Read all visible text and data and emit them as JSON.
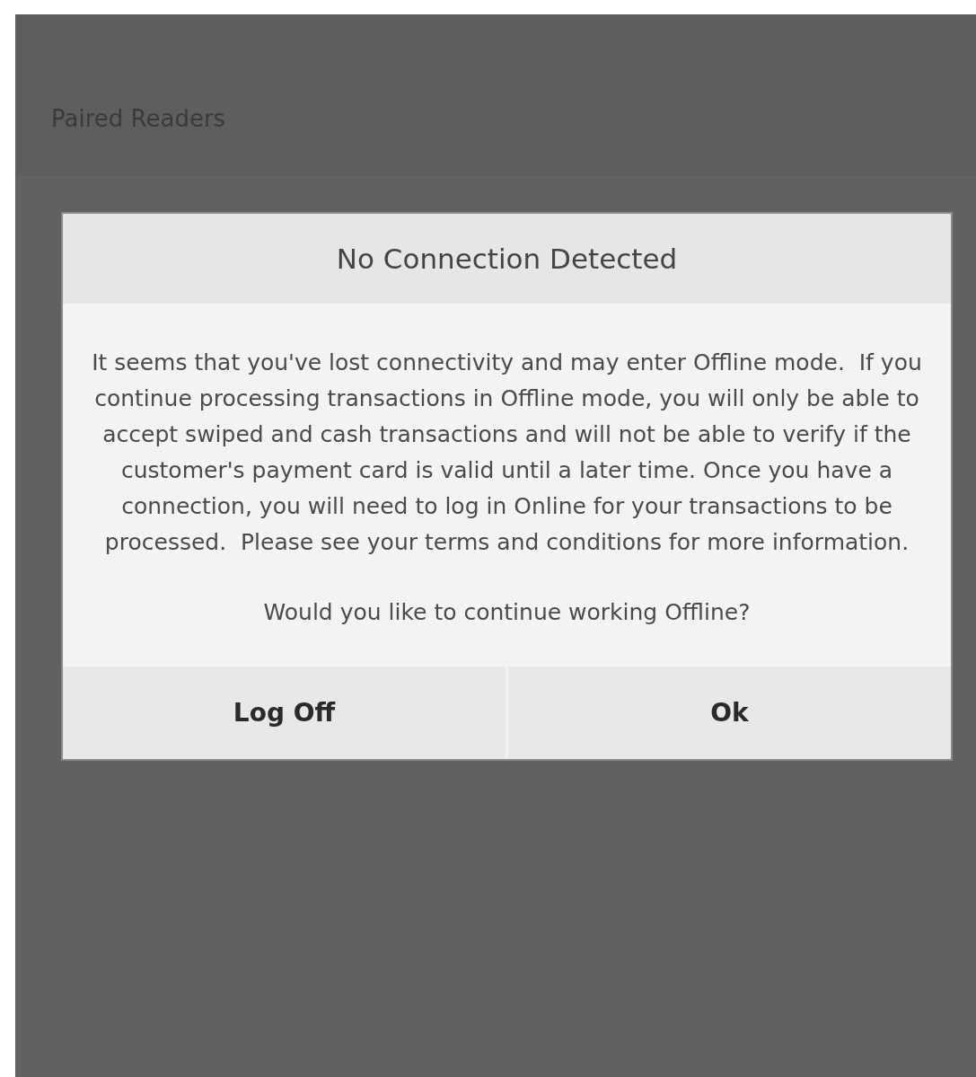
{
  "screen": {
    "header": "Paired Readers"
  },
  "dialog": {
    "title": "No Connection Detected",
    "message": "It seems that you've lost connectivity and may enter Offline mode.  If you continue processing transactions in Offline mode, you will only be able to accept swiped and cash transactions and will not be able to verify if the customer's payment card is valid until a later time. Once you have a connection, you will need to log in Online for your transactions to be processed.  Please see your terms and conditions for more information.",
    "question": "Would you like to continue working Offline?",
    "buttons": [
      "Log Off",
      "Ok"
    ]
  }
}
